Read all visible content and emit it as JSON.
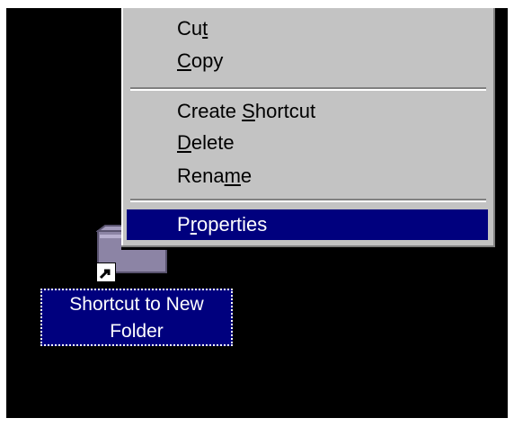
{
  "context_menu": {
    "items": [
      {
        "id": "cut",
        "pre": "Cu",
        "acc": "t",
        "post": ""
      },
      {
        "id": "copy",
        "pre": "",
        "acc": "C",
        "post": "opy"
      },
      {
        "id": "create-shortcut",
        "pre": "Create ",
        "acc": "S",
        "post": "hortcut"
      },
      {
        "id": "delete",
        "pre": "",
        "acc": "D",
        "post": "elete"
      },
      {
        "id": "rename",
        "pre": "Rena",
        "acc": "m",
        "post": "e"
      },
      {
        "id": "properties",
        "pre": "P",
        "acc": "r",
        "post": "operties"
      }
    ],
    "selected_item": "properties",
    "colors": {
      "menu_bg": "#c3c3c3",
      "highlight": "#00007e"
    }
  },
  "desktop_icon": {
    "label_line1": "Shortcut to New",
    "label_line2": "Folder",
    "icon": "folder-shortcut-icon",
    "overlay_icon": "shortcut-arrow-icon",
    "colors": {
      "folder": "#8c84a5",
      "label_bg": "#00007e"
    }
  },
  "desktop": {
    "background": "#000000"
  }
}
